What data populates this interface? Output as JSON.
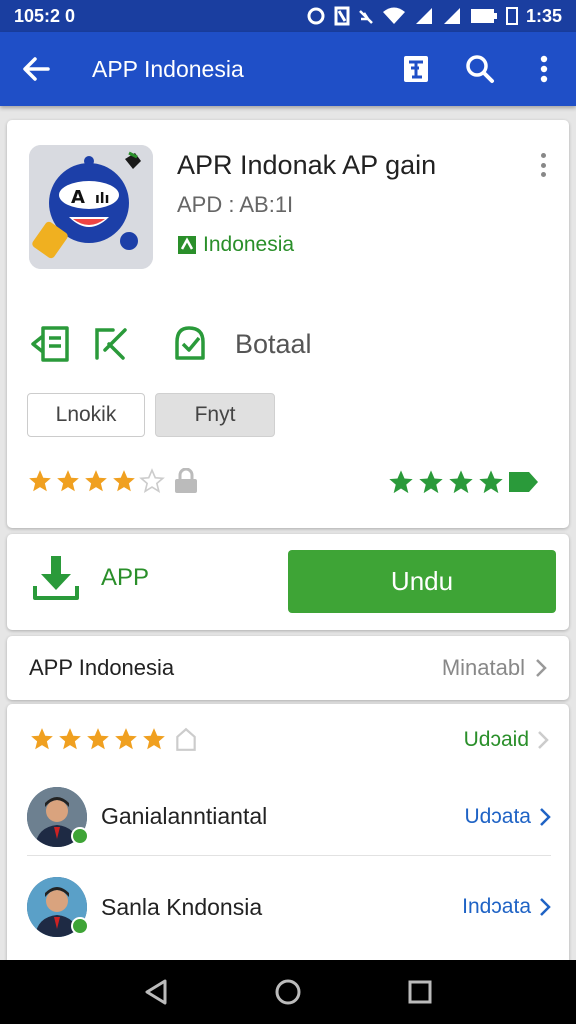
{
  "status": {
    "time_left": "105:2 0",
    "time_right": "1:35"
  },
  "appbar": {
    "title": "APP Indonesia"
  },
  "app": {
    "name": "APR Indonak AP gain",
    "subtitle": "APD : AB:1I",
    "developer": "Indonesia",
    "feature_label": "Botaal",
    "chip_1": "Lnokik",
    "chip_2": "Fnyt",
    "rating_stars": 4
  },
  "install": {
    "label": "APP",
    "button": "Undu"
  },
  "info": {
    "title": "APP Indonesia",
    "more": "Minatabl"
  },
  "reviews": {
    "header_link": "Udɔaid",
    "header_stars": 5,
    "items": [
      {
        "name": "Ganialanntiantal",
        "action": "Udɔata"
      },
      {
        "name": "Sanla Kndonsia",
        "action": "Indɔata"
      }
    ]
  },
  "colors": {
    "appbar": "#1f4fc7",
    "statusbar": "#1a3ea0",
    "accent_green": "#3ea436",
    "link_blue": "#1f63c5",
    "star_orange": "#f0a020"
  }
}
